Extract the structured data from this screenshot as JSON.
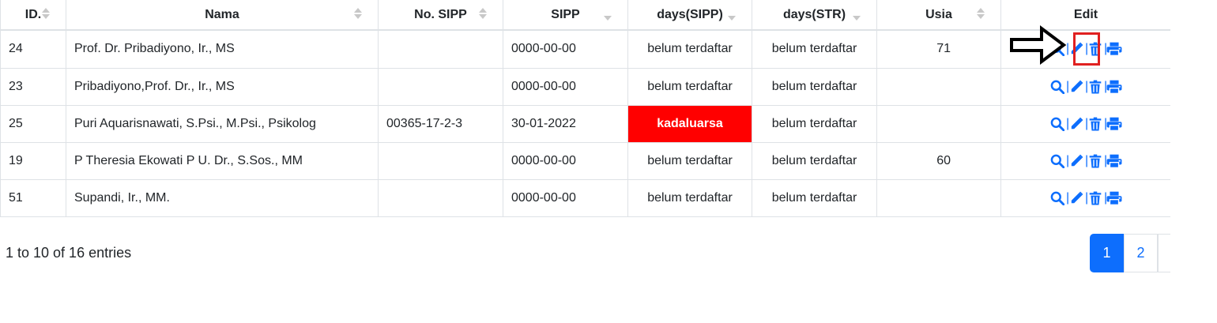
{
  "table": {
    "headers": [
      "ID.",
      "Nama",
      "No. SIPP",
      "SIPP",
      "days(SIPP)",
      "days(STR)",
      "Usia",
      "Edit"
    ],
    "rows": [
      {
        "id": "24",
        "nama": "Prof. Dr. Pribadiyono, Ir., MS",
        "no_sipp": "",
        "sipp": "0000-00-00",
        "days_sipp": "belum terdaftar",
        "days_str": "belum terdaftar",
        "usia": "71"
      },
      {
        "id": "23",
        "nama": "Pribadiyono,Prof. Dr., Ir., MS",
        "no_sipp": "",
        "sipp": "0000-00-00",
        "days_sipp": "belum terdaftar",
        "days_str": "belum terdaftar",
        "usia": ""
      },
      {
        "id": "25",
        "nama": "Puri Aquarisnawati, S.Psi., M.Psi., Psikolog",
        "no_sipp": "00365-17-2-3",
        "sipp": "30-01-2022",
        "days_sipp": "kadaluarsa",
        "days_str": "belum terdaftar",
        "usia": ""
      },
      {
        "id": "19",
        "nama": "P Theresia Ekowati P U. Dr., S.Sos., MM",
        "no_sipp": "",
        "sipp": "0000-00-00",
        "days_sipp": "belum terdaftar",
        "days_str": "belum terdaftar",
        "usia": "60"
      },
      {
        "id": "51",
        "nama": "Supandi, Ir., MM.",
        "no_sipp": "",
        "sipp": "0000-00-00",
        "days_sipp": "belum terdaftar",
        "days_str": "belum terdaftar",
        "usia": ""
      }
    ],
    "action_icons": [
      "search-icon",
      "pencil-icon",
      "trash-icon",
      "printer-icon"
    ],
    "action_separator": "|"
  },
  "footer": {
    "info": "1 to 10 of 16 entries"
  },
  "pagination": {
    "pages": [
      "1",
      "2"
    ],
    "active": "1"
  },
  "colors": {
    "accent": "#0d6efd",
    "expired": "#ff0000",
    "highlight": "#e02020"
  }
}
